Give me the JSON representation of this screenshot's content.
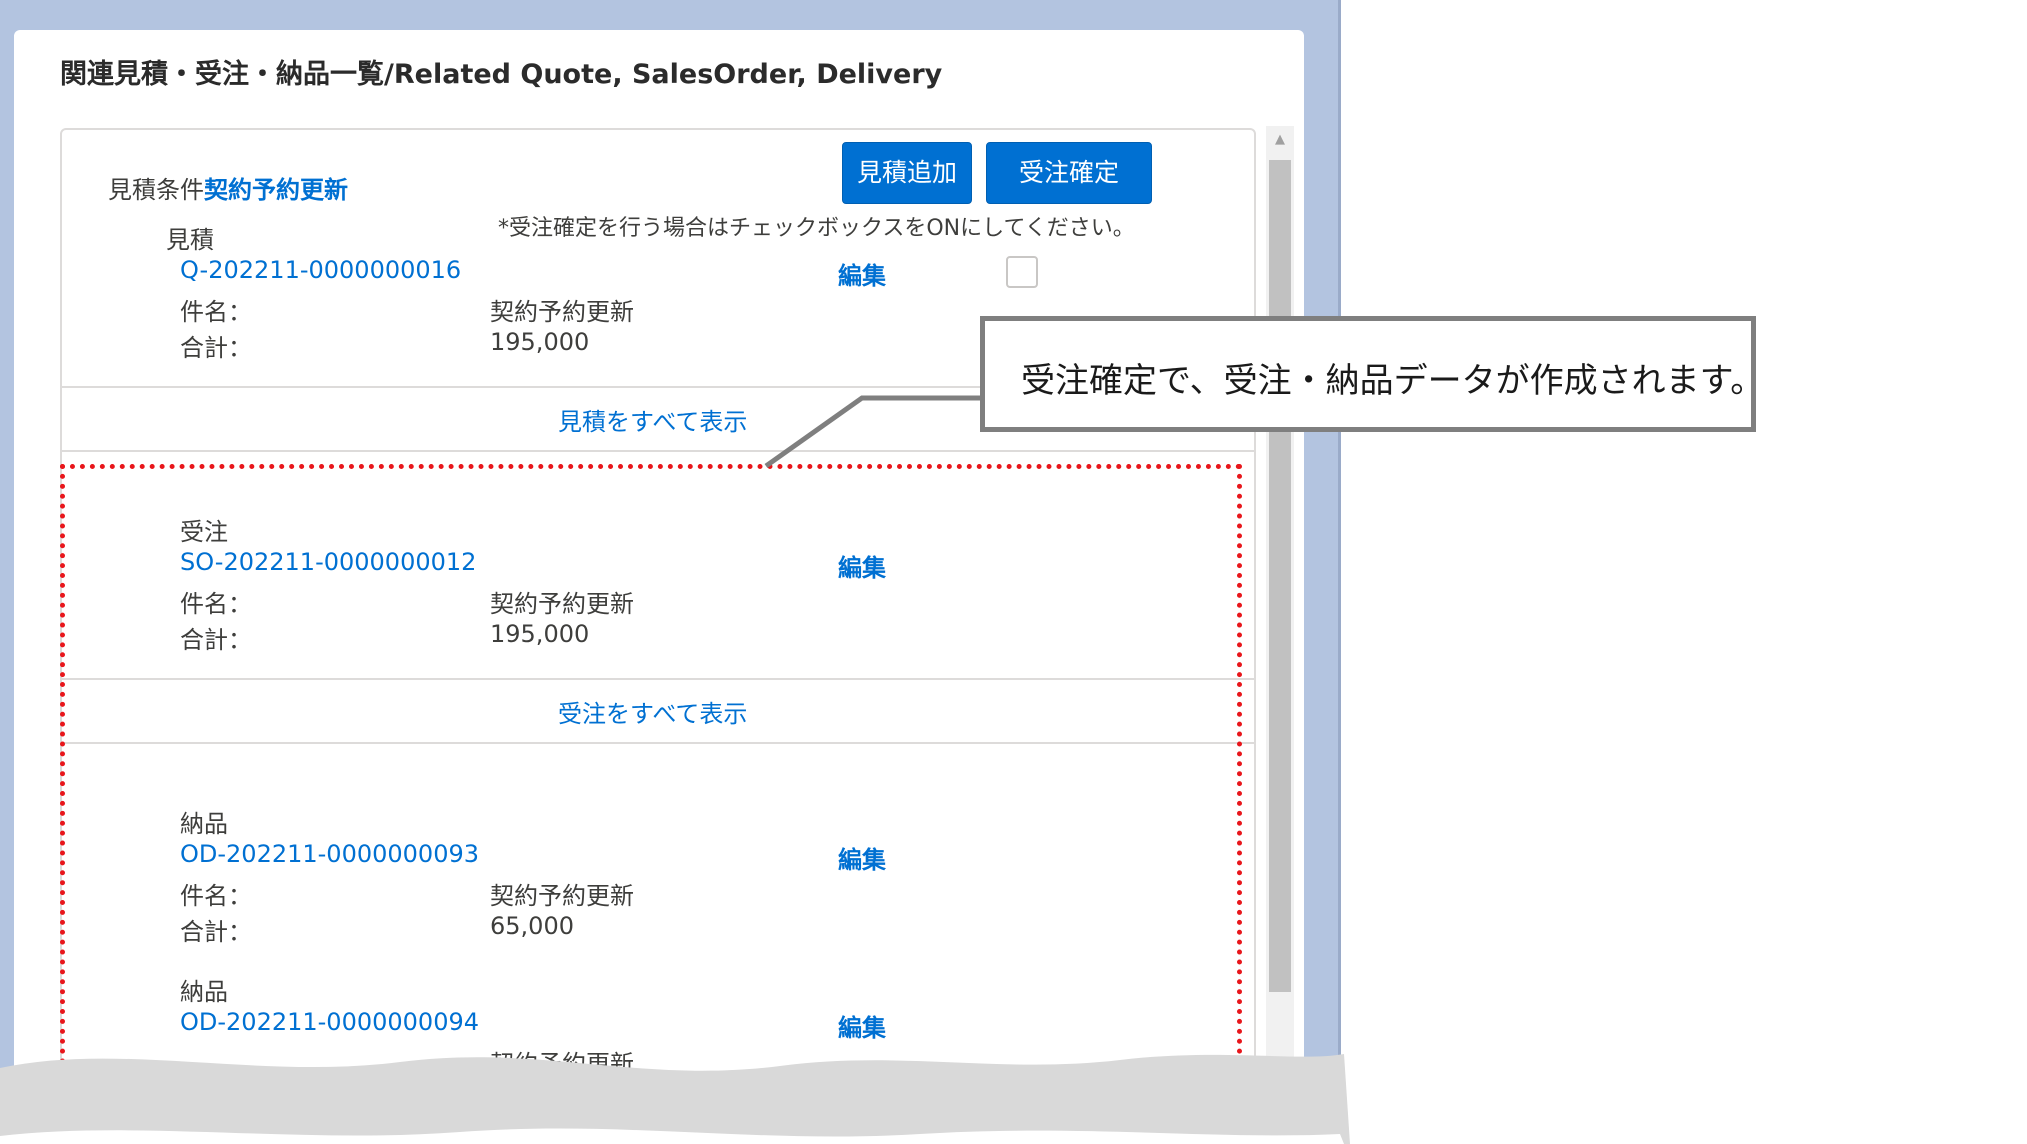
{
  "panel": {
    "title": "関連見積・受注・納品一覧/Related Quote, SalesOrder, Delivery"
  },
  "card": {
    "condition_label": "見積条件",
    "condition_value": "契約予約更新",
    "buttons": {
      "add_quote": "見積追加",
      "confirm_order": "受注確定"
    },
    "note": "*受注確定を行う場合はチェックボックスをONにしてください。",
    "edit_label": "編集",
    "field_name": "件名：",
    "field_total": "合計："
  },
  "quote": {
    "section": "見積",
    "number": "Q-202211-0000000016",
    "subject": "契約予約更新",
    "total": "195,000",
    "checkbox_checked": false,
    "view_all": "見積をすべて表示"
  },
  "sales_order": {
    "section": "受注",
    "number": "SO-202211-0000000012",
    "subject": "契約予約更新",
    "total": "195,000",
    "view_all": "受注をすべて表示"
  },
  "deliveries": [
    {
      "section": "納品",
      "number": "OD-202211-0000000093",
      "subject": "契約予約更新",
      "total": "65,000"
    },
    {
      "section": "納品",
      "number": "OD-202211-0000000094",
      "subject": "契約予約更新"
    }
  ],
  "callout": {
    "text": "受注確定で、受注・納品データが作成されます。"
  },
  "colors": {
    "link": "#0070d2",
    "button": "#0070d2",
    "highlight": "#e8161b",
    "frame": "#b3c4e0"
  }
}
